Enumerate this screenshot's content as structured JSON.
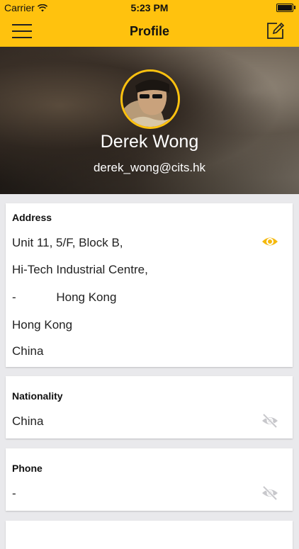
{
  "status": {
    "carrier": "Carrier",
    "time": "5:23 PM",
    "battery_level": 1.0
  },
  "nav": {
    "title": "Profile"
  },
  "profile": {
    "name": "Derek Wong",
    "email": "derek_wong@cits.hk"
  },
  "address": {
    "label": "Address",
    "lines": [
      "Unit 11, 5/F, Block B,",
      "Hi-Tech Industrial Centre,",
      "-            Hong Kong",
      "Hong Kong",
      "China"
    ],
    "visible": true
  },
  "nationality": {
    "label": "Nationality",
    "value": "China",
    "visible": false
  },
  "phone": {
    "label": "Phone",
    "value": "-",
    "visible": false
  },
  "colors": {
    "accent": "#ffc20e",
    "hidden_icon": "#c8c8cc"
  }
}
